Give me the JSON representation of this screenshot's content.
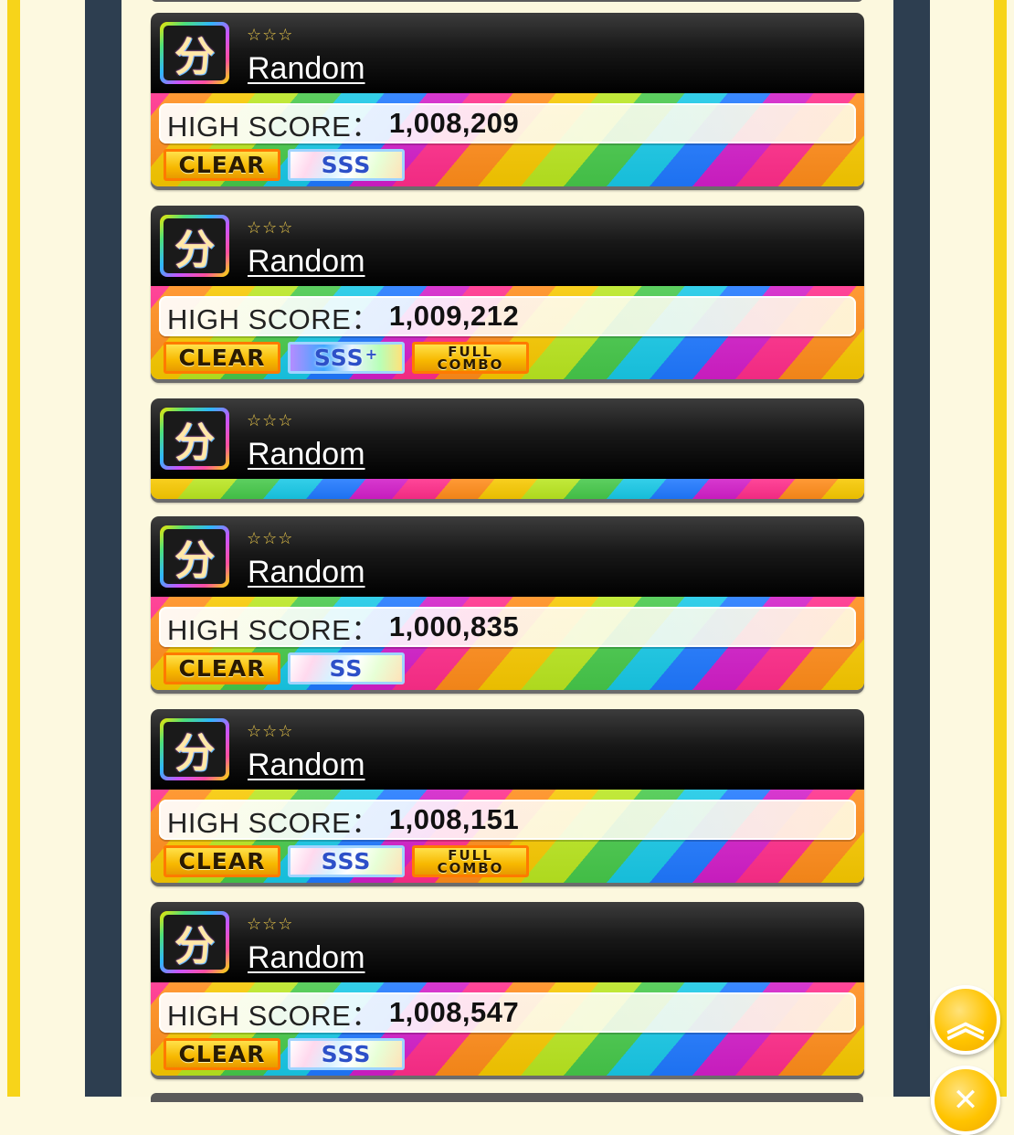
{
  "songs": [
    {
      "genre_icon": "分",
      "stars": "☆☆☆",
      "title": "Random",
      "score_label": "HIGH SCORE：",
      "score": "1,008,209",
      "clear": "CLEAR",
      "rank": "SSS",
      "rank_plus": "",
      "full_combo": false
    },
    {
      "genre_icon": "分",
      "stars": "☆☆☆",
      "title": "Random",
      "score_label": "HIGH SCORE：",
      "score": "1,009,212",
      "clear": "CLEAR",
      "rank": "SSS",
      "rank_plus": "+",
      "full_combo": true,
      "full_combo_line1": "FULL",
      "full_combo_line2": "COMBO"
    },
    {
      "genre_icon": "分",
      "stars": "☆☆☆",
      "title": "Random"
    },
    {
      "genre_icon": "分",
      "stars": "☆☆☆",
      "title": "Random",
      "score_label": "HIGH SCORE：",
      "score": "1,000,835",
      "clear": "CLEAR",
      "rank": "SS",
      "rank_plus": "",
      "full_combo": false
    },
    {
      "genre_icon": "分",
      "stars": "☆☆☆",
      "title": "Random",
      "score_label": "HIGH SCORE：",
      "score": "1,008,151",
      "clear": "CLEAR",
      "rank": "SSS",
      "rank_plus": "",
      "full_combo": true,
      "full_combo_line1": "FULL",
      "full_combo_line2": "COMBO"
    },
    {
      "genre_icon": "分",
      "stars": "☆☆☆",
      "title": "Random",
      "score_label": "HIGH SCORE：",
      "score": "1,008,547",
      "clear": "CLEAR",
      "rank": "SSS",
      "rank_plus": "",
      "full_combo": false
    }
  ],
  "scroll_buttons": {
    "up_icon": "chevron-double-up-icon",
    "up_glyph": "︽",
    "down_icon": "chevron-down-icon",
    "down_glyph": "✕"
  },
  "colors": {
    "frame_yellow": "#f7d41a",
    "frame_navy": "#2d3e50",
    "page_bg": "#fcf8de",
    "button_gold": "#ffc400"
  }
}
